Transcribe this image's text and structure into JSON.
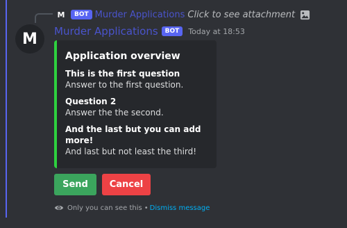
{
  "reply": {
    "avatar_letter": "M",
    "badge": "BOT",
    "name": "Murder Applications",
    "attachment_text": "Click to see attachment",
    "image_icon": "image-icon"
  },
  "message": {
    "avatar_letter": "M",
    "author": "Murder Applications",
    "badge": "BOT",
    "timestamp": "Today at 18:53"
  },
  "embed": {
    "accent_color": "#2ed13f",
    "title": "Application overview",
    "fields": [
      {
        "name": "This is the first question",
        "value": "Answer to the first question."
      },
      {
        "name": "Question 2",
        "value": "Answer the the second."
      },
      {
        "name": "And the last but you can add more!",
        "value": "And last but not least the third!"
      }
    ]
  },
  "buttons": {
    "send_label": "Send",
    "cancel_label": "Cancel"
  },
  "ephemeral": {
    "icon": "eye-icon",
    "text": "Only you can see this",
    "separator": "•",
    "dismiss_label": "Dismiss message"
  },
  "colors": {
    "background": "#2f3136",
    "embed_background": "#26282c",
    "blurple": "#5865f2",
    "username": "#4a54cc",
    "send": "#3ba55d",
    "cancel": "#ed4245",
    "link": "#00aff4"
  }
}
